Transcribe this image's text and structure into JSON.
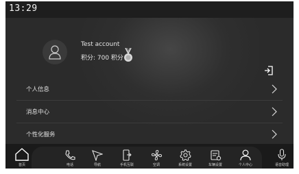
{
  "status_bar": {
    "time": "13:29"
  },
  "profile": {
    "username": "Test account",
    "points": "积分: 700 积分"
  },
  "menu": [
    {
      "label": "个人信息"
    },
    {
      "label": "消息中心"
    },
    {
      "label": "个性化服务"
    }
  ],
  "nav": [
    {
      "label": "首页",
      "icon": "home-icon"
    },
    {
      "label": "电话",
      "icon": "phone-icon"
    },
    {
      "label": "导航",
      "icon": "navigation-icon"
    },
    {
      "label": "手机互联",
      "icon": "phone-link-icon"
    },
    {
      "label": "空调",
      "icon": "fan-icon"
    },
    {
      "label": "系统设置",
      "icon": "gear-icon"
    },
    {
      "label": "车辆设置",
      "icon": "car-settings-icon"
    },
    {
      "label": "个人中心",
      "icon": "person-icon"
    },
    {
      "label": "语音助理",
      "icon": "microphone-icon"
    }
  ],
  "colors": {
    "screen_bg": "#2b2b2b",
    "bar_bg": "#1a1a1a",
    "text": "#e6e6e6"
  }
}
